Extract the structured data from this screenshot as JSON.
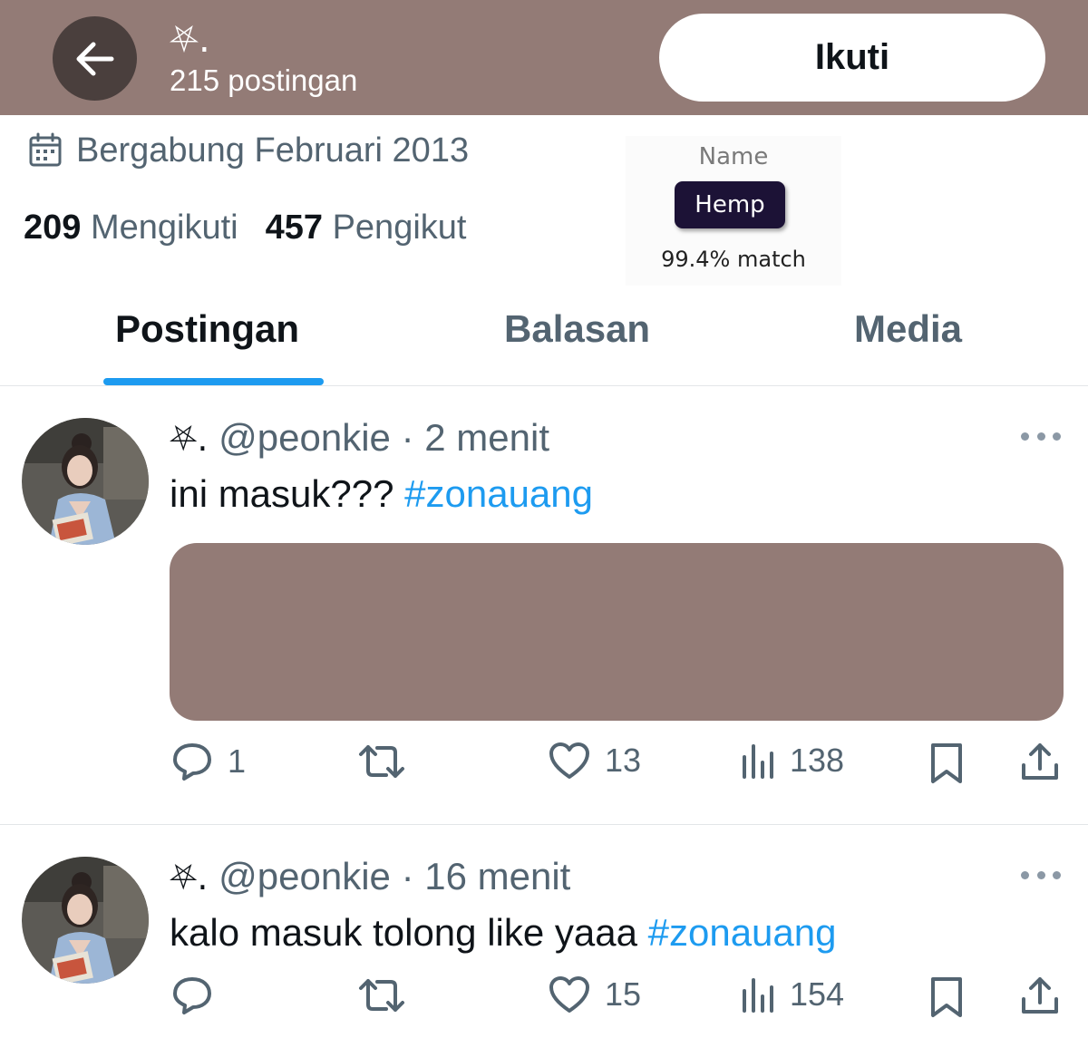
{
  "header": {
    "back_icon": "arrow-left-icon",
    "display_name": "⛧.",
    "post_count": "215 postingan",
    "follow_label": "Ikuti",
    "background_color": "#937b76"
  },
  "profile": {
    "joined_icon": "calendar-icon",
    "joined": "Bergabung Februari 2013",
    "following_count": "209",
    "following_label": "Mengikuti",
    "followers_count": "457",
    "followers_label": "Pengikut"
  },
  "sticker": {
    "label": "Name",
    "value": "Hemp",
    "match": "99.4% match"
  },
  "tabs": [
    {
      "label": "Postingan",
      "active": true
    },
    {
      "label": "Balasan",
      "active": false
    },
    {
      "label": "Media",
      "active": false
    }
  ],
  "posts": [
    {
      "display_name": "⛧.",
      "handle": "@peonkie",
      "separator": "·",
      "time": "2 menit",
      "text": "ini masuk??? ",
      "hashtag": "#zonauang",
      "has_media": true,
      "replies": "1",
      "likes": "13",
      "views": "138"
    },
    {
      "display_name": "⛧.",
      "handle": "@peonkie",
      "separator": "·",
      "time": "16 menit",
      "text": "kalo masuk tolong like yaaa ",
      "hashtag": "#zonauang",
      "has_media": false,
      "replies": "",
      "likes": "15",
      "views": "154"
    }
  ],
  "colors": {
    "accent": "#1d9bf0",
    "text_primary": "#0f1419",
    "text_secondary": "#536471",
    "redaction": "#937b76"
  }
}
